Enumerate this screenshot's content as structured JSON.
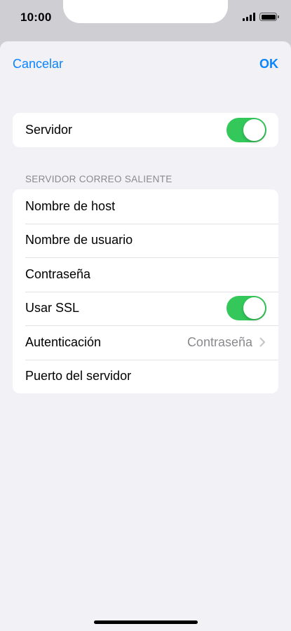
{
  "status_bar": {
    "time": "10:00"
  },
  "nav": {
    "cancel_label": "Cancelar",
    "ok_label": "OK"
  },
  "server_group": {
    "label": "Servidor",
    "toggle_on": true
  },
  "outgoing_section": {
    "header": "SERVIDOR CORREO SALIENTE",
    "rows": [
      {
        "label": "Nombre de host"
      },
      {
        "label": "Nombre de usuario"
      },
      {
        "label": "Contraseña"
      },
      {
        "label": "Usar SSL",
        "toggle_on": true
      },
      {
        "label": "Autenticación",
        "value": "Contraseña"
      },
      {
        "label": "Puerto del servidor"
      }
    ]
  },
  "colors": {
    "accent": "#0a84ff",
    "toggle_on": "#34c759",
    "background": "#f1f1f6"
  }
}
